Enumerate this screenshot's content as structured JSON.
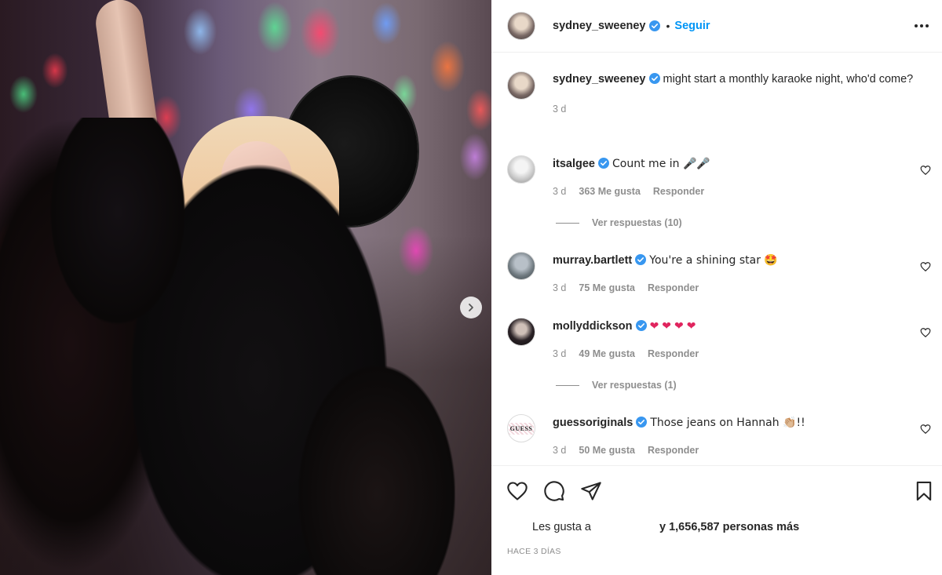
{
  "post": {
    "username": "sydney_sweeney",
    "follow_label": "Seguir",
    "separator": "•",
    "caption": "might start a monthly karaoke night, who'd come?",
    "caption_age": "3 d"
  },
  "comments": [
    {
      "username": "itsalgee",
      "text": "Count me in 🎤🎤",
      "age": "3 d",
      "likes": "363 Me gusta",
      "reply": "Responder",
      "view_replies": "Ver respuestas (10)"
    },
    {
      "username": "murray.bartlett",
      "text": "You're a shining star 🤩",
      "age": "3 d",
      "likes": "75 Me gusta",
      "reply": "Responder"
    },
    {
      "username": "mollyddickson",
      "text": "❤❤❤❤",
      "age": "3 d",
      "likes": "49 Me gusta",
      "reply": "Responder",
      "view_replies": "Ver respuestas (1)"
    },
    {
      "username": "guessoriginals",
      "text": "Those jeans on Hannah 👏🏼!!",
      "age": "3 d",
      "likes": "50 Me gusta",
      "reply": "Responder",
      "avatar_text": "GUESS"
    }
  ],
  "likes_block": {
    "prefix": "Les gusta a",
    "suffix": "y 1,656,587 personas más"
  },
  "timestamp": "HACE 3 DÍAS",
  "colors": {
    "link_blue": "#0095f6",
    "verified_blue": "#3897f0",
    "heart_red": "#ed4956",
    "muted": "#8e8e8e"
  },
  "icons": {
    "verified": "verified-badge-icon",
    "like": "heart-icon",
    "comment": "comment-bubble-icon",
    "share": "paper-plane-icon",
    "save": "bookmark-icon",
    "next": "chevron-right-icon",
    "more": "more-options-icon"
  }
}
